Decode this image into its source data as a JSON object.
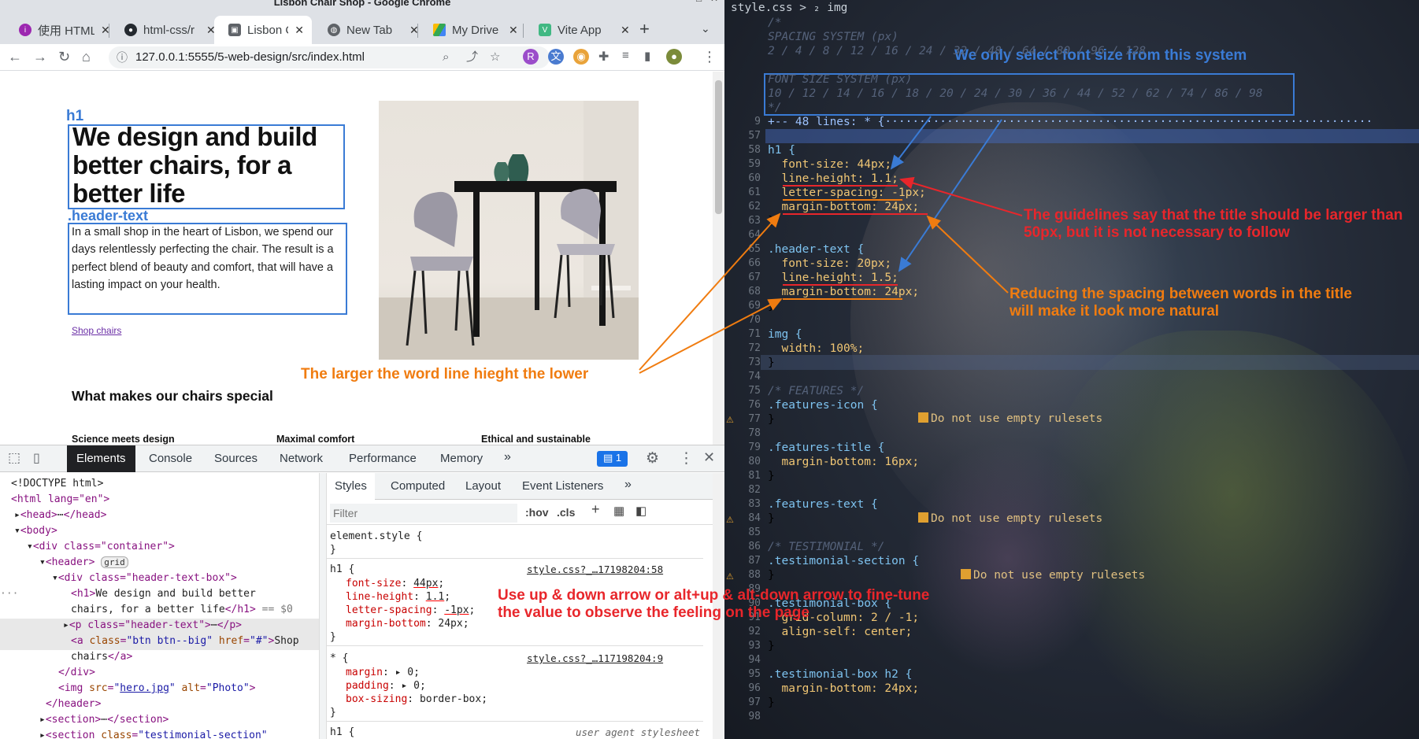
{
  "window_title": "Lisbon Chair Shop - Google Chrome",
  "tabs": [
    {
      "label": "使用 HTML",
      "favicon": "html-icon"
    },
    {
      "label": "html-css/r",
      "favicon": "github-icon"
    },
    {
      "label": "Lisbon Ch",
      "favicon": "chrome-icon",
      "active": true
    },
    {
      "label": "New Tab",
      "favicon": "chrome-icon"
    },
    {
      "label": "My Drive",
      "favicon": "drive-icon"
    },
    {
      "label": "Vite App",
      "favicon": "vite-icon"
    }
  ],
  "url": "127.0.0.1:5555/5-web-design/src/index.html",
  "page": {
    "h1_label": "h1",
    "h1": "We design and build better chairs, for a better life",
    "header_text_label": ".header-text",
    "header_text": "In a small shop in the heart of Lisbon, we spend our days relentlessly perfecting the chair. The result is a perfect blend of beauty and comfort, that will have a lasting impact on your health.",
    "shop_link": "Shop chairs",
    "section_title": "What makes our chairs special",
    "features": [
      "Science meets design",
      "Maximal comfort",
      "Ethical and sustainable"
    ]
  },
  "annotations": {
    "larger_line_height": "The larger the word line hieght the lower",
    "only_select": "We only select font size from this system",
    "guidelines": "The guidelines say that the title should be larger than 50px, but it is not necessary to follow",
    "reducing": "Reducing the spacing between words in the title will make it look more natural",
    "arrows": "Use up & down arrow or alt+up & alt-down arrow to fine-tune the value to observe the feeling on the page"
  },
  "devtools": {
    "tabs": [
      "Elements",
      "Console",
      "Sources",
      "Network",
      "Performance",
      "Memory"
    ],
    "issues_count": "1",
    "styles_tabs": [
      "Styles",
      "Computed",
      "Layout",
      "Event Listeners"
    ],
    "filter_placeholder": "Filter",
    "hov": ":hov",
    "cls": ".cls",
    "element_style": "element.style {",
    "h1_source": "style.css?_…17198204:58",
    "star_source": "style.css?_…117198204:9",
    "user_agent": "user agent stylesheet",
    "h1_rule": {
      "selector": "h1 {",
      "props": [
        {
          "name": "font-size",
          "value": "44px"
        },
        {
          "name": "line-height",
          "value": "1.1"
        },
        {
          "name": "letter-spacing",
          "value": "-1px"
        },
        {
          "name": "margin-bottom",
          "value": "24px"
        }
      ]
    },
    "star_rule": {
      "selector": "* {",
      "props": [
        {
          "name": "margin",
          "value": "0"
        },
        {
          "name": "padding",
          "value": "0"
        },
        {
          "name": "box-sizing",
          "value": "border-box"
        }
      ]
    },
    "dom": {
      "doctype": "<!DOCTYPE html>",
      "html_open": "<html lang=\"en\">",
      "head": "<head>",
      "body": "<body>",
      "container": "<div class=\"container\">",
      "header": "<header>",
      "grid_badge": "grid",
      "header_text_box": "<div class=\"header-text-box\">",
      "h1_line1": "We design and build better",
      "h1_line2": "chairs, for a better life",
      "eq0": "== $0",
      "p_header_text": "<p class=\"header-text\">",
      "a_btn": "Shop",
      "a_btn2": "chairs",
      "img_src": "hero.jpg",
      "img_alt": "Photo"
    }
  },
  "editor": {
    "breadcrumb": "style.css > ₂ img",
    "lines": [
      {
        "n": "",
        "t": "/*"
      },
      {
        "n": "",
        "t": "SPACING SYSTEM (px)"
      },
      {
        "n": "",
        "t": "2 / 4 / 8 / 12 / 16 / 24 / 32 / 48 / 64 / 80 / 96 / 128"
      },
      {
        "n": "",
        "t": ""
      },
      {
        "n": "",
        "t": "FONT SIZE SYSTEM (px)"
      },
      {
        "n": "",
        "t": "10 / 12 / 14 / 16 / 18 / 20 / 24 / 30 / 36 / 44 / 52 / 62 / 74 / 86 / 98"
      },
      {
        "n": "",
        "t": "*/"
      },
      {
        "n": "9",
        "t": "+-- 48 lines: * {·······································································"
      },
      {
        "n": "57",
        "t": ""
      },
      {
        "n": "58",
        "t": "h1 {"
      },
      {
        "n": "59",
        "t": "  font-size: 44px;"
      },
      {
        "n": "60",
        "t": "  line-height: 1.1;"
      },
      {
        "n": "61",
        "t": "  letter-spacing: -1px;"
      },
      {
        "n": "62",
        "t": "  margin-bottom: 24px;"
      },
      {
        "n": "63",
        "t": "}"
      },
      {
        "n": "64",
        "t": ""
      },
      {
        "n": "65",
        "t": ".header-text {"
      },
      {
        "n": "66",
        "t": "  font-size: 20px;"
      },
      {
        "n": "67",
        "t": "  line-height: 1.5;"
      },
      {
        "n": "68",
        "t": "  margin-bottom: 24px;"
      },
      {
        "n": "69",
        "t": "}"
      },
      {
        "n": "70",
        "t": ""
      },
      {
        "n": "71",
        "t": "img {"
      },
      {
        "n": "72",
        "t": "  width: 100%;"
      },
      {
        "n": "73",
        "t": "}"
      },
      {
        "n": "74",
        "t": ""
      },
      {
        "n": "75",
        "t": "/* FEATURES */"
      },
      {
        "n": "76",
        "t": ".features-icon {"
      },
      {
        "n": "77",
        "t": "}"
      },
      {
        "n": "78",
        "t": ""
      },
      {
        "n": "79",
        "t": ".features-title {"
      },
      {
        "n": "80",
        "t": "  margin-bottom: 16px;"
      },
      {
        "n": "81",
        "t": "}"
      },
      {
        "n": "82",
        "t": ""
      },
      {
        "n": "83",
        "t": ".features-text {"
      },
      {
        "n": "84",
        "t": "}"
      },
      {
        "n": "85",
        "t": ""
      },
      {
        "n": "86",
        "t": "/* TESTIMONIAL */"
      },
      {
        "n": "87",
        "t": ".testimonial-section {"
      },
      {
        "n": "88",
        "t": "}"
      },
      {
        "n": "89",
        "t": ""
      },
      {
        "n": "90",
        "t": ".testimonial-box {"
      },
      {
        "n": "91",
        "t": "  grid-column: 2 / -1;"
      },
      {
        "n": "92",
        "t": "  align-self: center;"
      },
      {
        "n": "93",
        "t": "}"
      },
      {
        "n": "94",
        "t": ""
      },
      {
        "n": "95",
        "t": ".testimonial-box h2 {"
      },
      {
        "n": "96",
        "t": "  margin-bottom: 24px;"
      },
      {
        "n": "97",
        "t": "}"
      },
      {
        "n": "98",
        "t": ""
      }
    ],
    "warning": "Do not use empty rulesets"
  },
  "colors": {
    "annotation_blue": "#3a7bd5",
    "annotation_orange": "#f07c10",
    "annotation_red": "#e8262b"
  }
}
